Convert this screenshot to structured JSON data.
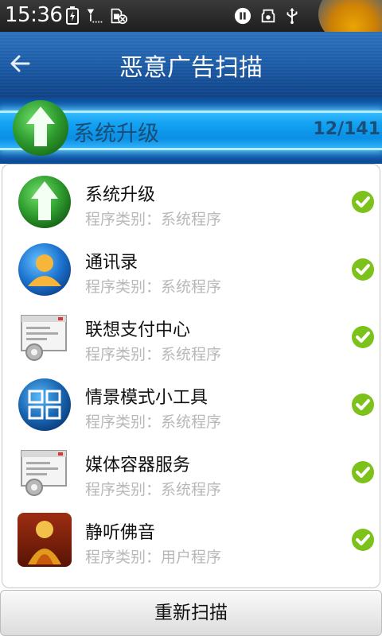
{
  "status_bar": {
    "time": "15:36",
    "icons": [
      "battery-icon",
      "signal-icon",
      "sim-off-icon",
      "media-pause-icon",
      "usb-debug-icon",
      "usb-icon"
    ]
  },
  "header": {
    "title": "恶意广告扫描",
    "back_icon": "back-arrow-icon"
  },
  "scan": {
    "current_item": "系统升级",
    "progress_text": "12/141",
    "icon": "system-upgrade-icon"
  },
  "list": {
    "items": [
      {
        "name": "系统升级",
        "category": "程序类别：系统程序",
        "icon": "system-upgrade-icon",
        "status": "check-icon"
      },
      {
        "name": "通讯录",
        "category": "程序类别：系统程序",
        "icon": "contacts-icon",
        "status": "check-icon"
      },
      {
        "name": "联想支付中心",
        "category": "程序类别：系统程序",
        "icon": "app-settings-icon",
        "status": "check-icon"
      },
      {
        "name": "情景模式小工具",
        "category": "程序类别：系统程序",
        "icon": "profile-widget-icon",
        "status": "check-icon"
      },
      {
        "name": "媒体容器服务",
        "category": "程序类别：系统程序",
        "icon": "app-settings-icon",
        "status": "check-icon"
      },
      {
        "name": "静听佛音",
        "category": "程序类别：用户程序",
        "icon": "buddha-music-icon",
        "status": "check-icon"
      }
    ]
  },
  "footer": {
    "rescan_label": "重新扫描"
  },
  "colors": {
    "title_bar": "#1b5aa6",
    "scan_band": "#15a4f4",
    "check_green": "#7cc21a",
    "category_gray": "#b8b8b8"
  }
}
